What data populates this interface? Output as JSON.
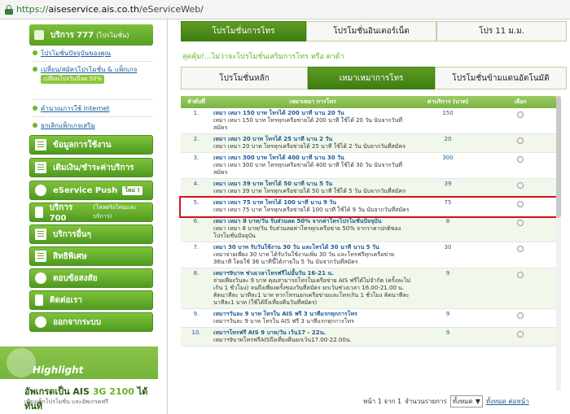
{
  "browser": {
    "url_scheme": "https://",
    "url_host": "aiseservice.ais.co.th",
    "url_path": "/eServiceWeb/"
  },
  "sidebar": {
    "top_item": {
      "label": "บริการ 777",
      "sub": "(โปรโมชั่น)"
    },
    "sub_items": [
      {
        "label": "โปรโมชั่นปัจจุบันของคุณ"
      },
      {
        "label": "เปลี่ยน/สมัครโปรโมชั่น & แพ็กเกจ",
        "badge": "เปลี่ยนโปรวันนี้ลด 50%"
      },
      {
        "label": "คำนวณการใช้ Internet"
      },
      {
        "label": "ยกเลิกแพ็กเกจเสริม"
      }
    ],
    "items": [
      {
        "label": "ข้อมูลการใช้งาน"
      },
      {
        "label": "เติมเงิน/ชำระค่าบริการ"
      },
      {
        "label": "eService Push",
        "tag": "ใหม่ !"
      },
      {
        "label": "บริการ 700",
        "sub": "(โหลดริงโทนและบริการ)"
      },
      {
        "label": "บริการอื่นๆ"
      },
      {
        "label": "สิทธิพิเศษ"
      },
      {
        "label": "ตอบข้อสงสัย"
      },
      {
        "label": "ติดต่อเรา"
      },
      {
        "label": "ออกจากระบบ"
      }
    ],
    "highlight": {
      "title": "Highlight",
      "promo_line1_a": "อัพเกรดเป็น AIS ",
      "promo_line1_b": "3G 2100",
      "promo_line1_c": " ได้ทันที",
      "promo_line2": "เพียงเช็กโปรโมชั่น และอัพเกรดฟรี"
    }
  },
  "main": {
    "tabs": [
      "โปรโมชั่นการโทร",
      "โปรโมชั่นอินเตอร์เน็ต",
      "โปร 11 ม.ม."
    ],
    "subtitle": "สุดคุ้ม!...ไม่ว่าจะโปรโมชั่นเสริมการโทร หรือ ดาต้า",
    "subtabs": [
      "โปรโมชั่นหลัก",
      "เหมาเหมาการโทร",
      "โปรโมชั่นข้ามแดนอัตโนมัติ"
    ],
    "table": {
      "headers": [
        "ลำดับที่",
        "เหมาเหมา การโทร",
        "ค่าบริการ (บาท)",
        "เลือก"
      ],
      "rows": [
        {
          "num": "1.",
          "title": "เหมา เหมา 150 บาท โทรได้ 200 นาที นาน 20 วัน",
          "desc": "เหมา เหมา 150 บาท โทรทุกเครือข่ายได้ 200 นาที ใช้ได้ 20 วัน นับจากวันที่สมัคร",
          "price": "150"
        },
        {
          "num": "2.",
          "title": "เหมา เหมา 20 บาท โทรได้ 25 นาที นาน 2 วัน",
          "desc": "เหมา เหมา 20 บาท โทรทุกเครือข่ายได้ 25 นาที ใช้ได้ 2 วัน นับจากวันที่สมัคร",
          "price": "20"
        },
        {
          "num": "3.",
          "title": "เหมา เหมา 300 บาท โทรได้ 400 นาที นาน 30 วัน",
          "desc": "เหมา เหมา 300 บาท โทรทุกเครือข่ายได้ 400 นาที ใช้ได้ 30 วัน นับจากวันที่สมัคร",
          "price": "300"
        },
        {
          "num": "4.",
          "title": "เหมา เหมา 39 บาท โทรได้ 50 นาที นาน 5 วัน",
          "desc": "เหมา เหมา 39 บาท โทรทุกเครือข่ายได้ 50 นาที ใช้ได้ 5 วัน นับจากวันที่สมัคร",
          "price": "39"
        },
        {
          "num": "5.",
          "title": "เหมา เหมา 75 บาท โทรได้ 100 นาที นาน 9 วัน",
          "desc": "เหมา เหมา 75 บาท โทรทุกเครือข่ายได้ 100 นาที ใช้ได้ 9 วัน นับจากวันที่สมัคร",
          "price": "75"
        },
        {
          "num": "6.",
          "title": "เหมา เหมา 8 บาท/วัน รับส่วนลด 50% จากค่าโทรโปรโมชั่นปัจจุบัน",
          "desc": "เหมา เหมา 8 บาท/วัน รับส่วนลดค่าโทรทุกเครือข่าย 50% จากราคาปกติของ โปรโมชั่นปัจจุบัน",
          "price": "8"
        },
        {
          "num": "7.",
          "title": "เหมา 30 บาท รับวันใช้งาน 30 วัน และโทรได้ 30 นาที นาน 5 วัน",
          "desc": "เหมาจ่ายเพียง 30 บาท ได้รับวันใช้งานเพิ่ม 30 วัน และโทรฟรีทุกเครือข่าย 36นาที โดยใช้ 36 นาทีนี้ได้ภายใน 5 วัน นับจากวันที่สมัคร",
          "price": "30"
        },
        {
          "num": "8.",
          "title": "เหมาฯ9บาท ช่วงเวลาโทรฟรีไม่อั้นวัน 16-21 น.",
          "desc": "จ่ายเพียงวันละ 9 บาท คุณสามารถโทรในเครือข่าย AIS ฟรีได้ไม่จำกัด (ครั้งละไม่เกิน 1 ชั่วโมง) จนถึงเพียงครั้งของวันที่สมัคร ยกเว้นช่วงเวลา 16.00-21.00 น. คิดนาทีละ นาทีละ1 บาท หากโทรนอกเครือข่ายและโทรเกิน 1 ชั่วโมง คิดนาทีละ นาทีละ1 บาท (ใช้ได้ถึงเที่ยงคืนวันที่สมัคร)",
          "price": "9"
        },
        {
          "num": "9.",
          "title": "เหมาฯวันละ 9 บาท โทรใน AIS ฟรี 3 นาทีแรกทุกการโทร",
          "desc": "เหมาฯวันละ 9 บาท โทรใน AIS ฟรี 3 นาทีแรกทุกการโทร",
          "price": "9"
        },
        {
          "num": "10.",
          "title": "เหมาฯโทรฟรี AIS 9 บาท/วัน เว้น17 - 22น.",
          "desc": "เหมาฯ9บาทโทรฟรีAISถึงเที่ยงคืนยกเว้น17.00-22.00น.",
          "price": "9"
        }
      ]
    },
    "pager": {
      "page_info": "หน้า 1 จาก 1",
      "per_page_label": "จำนวนรายการ",
      "per_page_value": "ทั้งหมด",
      "show_all": "ทั้งหมด ต่อหน้า"
    }
  },
  "colors": {
    "green_dark": "#3f7d12",
    "green": "#7cb342",
    "link_blue": "#1c5a96",
    "highlight_red": "#d2141b"
  }
}
